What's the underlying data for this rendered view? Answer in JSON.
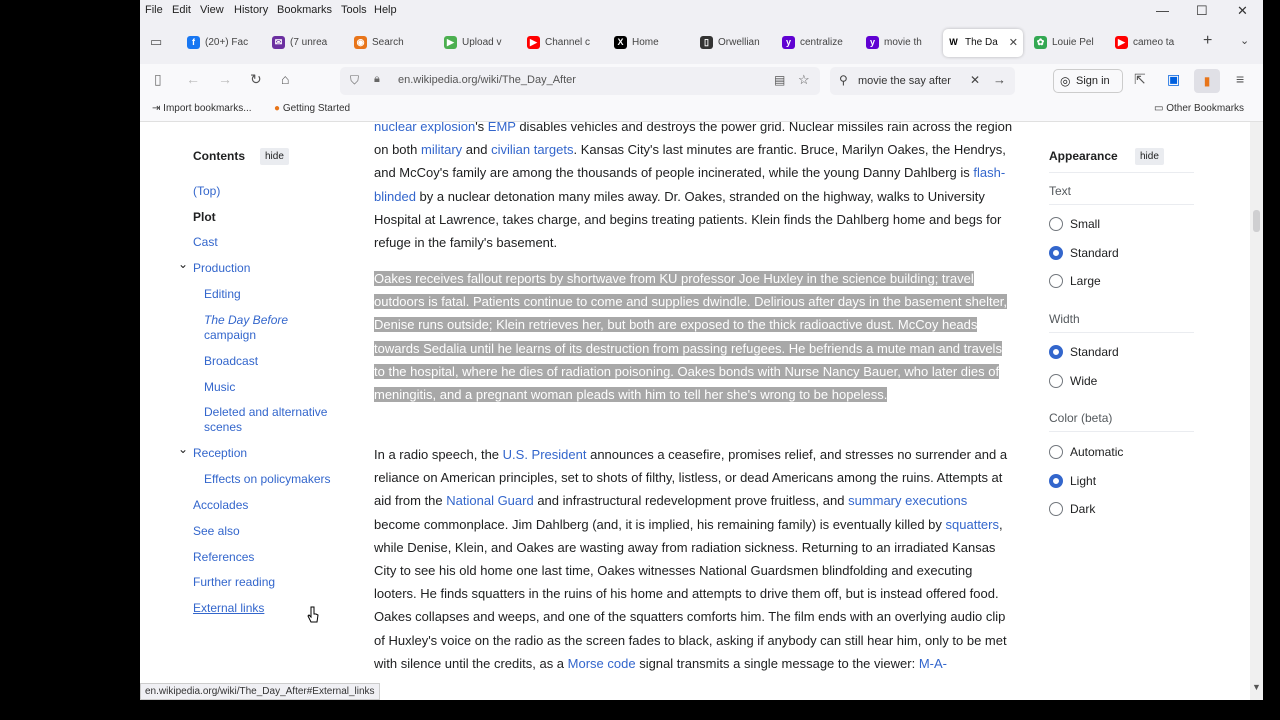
{
  "menu": [
    "File",
    "Edit",
    "View",
    "History",
    "Bookmarks",
    "Tools",
    "Help"
  ],
  "tabs": [
    {
      "label": "(20+) Fac",
      "color": "#1877f2",
      "glyph": "f"
    },
    {
      "label": "(7 unrea",
      "color": "#6b2fa0",
      "glyph": "✉"
    },
    {
      "label": "Search",
      "color": "#e8751a",
      "glyph": "◉"
    },
    {
      "label": "Upload v",
      "color": "#4caf50",
      "glyph": "▶"
    },
    {
      "label": "Channel c",
      "color": "#ff0000",
      "glyph": "▶"
    },
    {
      "label": "Home",
      "color": "#000000",
      "glyph": "X"
    },
    {
      "label": "Orwellian",
      "color": "#333333",
      "glyph": "▯"
    },
    {
      "label": "centralize",
      "color": "#6001d2",
      "glyph": "y"
    },
    {
      "label": "movie th",
      "color": "#6001d2",
      "glyph": "y"
    },
    {
      "label": "The Da",
      "color": "#ffffff",
      "glyph": "W"
    },
    {
      "label": "Louie Pel",
      "color": "#34a853",
      "glyph": "✿"
    },
    {
      "label": "cameo ta",
      "color": "#ff0000",
      "glyph": "▶"
    }
  ],
  "nav": {
    "url": "en.wikipedia.org/wiki/The_Day_After",
    "search_value": "movie the say after",
    "signin": "Sign in"
  },
  "bookmarks": {
    "import": "Import bookmarks...",
    "getting_started": "Getting Started",
    "other": "Other Bookmarks"
  },
  "toc": {
    "title": "Contents",
    "hide": "hide",
    "items": [
      {
        "label": "(Top)",
        "level": 1
      },
      {
        "label": "Plot",
        "level": 1,
        "active": true
      },
      {
        "label": "Cast",
        "level": 1
      },
      {
        "label": "Production",
        "level": 1,
        "expanded": true
      },
      {
        "label": "Editing",
        "level": 2
      },
      {
        "label": "The Day Before",
        "label2": "campaign",
        "level": 2,
        "italic": true
      },
      {
        "label": "Broadcast",
        "level": 2
      },
      {
        "label": "Music",
        "level": 2
      },
      {
        "label": "Deleted and alternative",
        "label2": "scenes",
        "level": 2
      },
      {
        "label": "Reception",
        "level": 1,
        "expanded": true
      },
      {
        "label": "Effects on policymakers",
        "level": 2
      },
      {
        "label": "Accolades",
        "level": 1
      },
      {
        "label": "See also",
        "level": 1
      },
      {
        "label": "References",
        "level": 1
      },
      {
        "label": "Further reading",
        "level": 1
      },
      {
        "label": "External links",
        "level": 1,
        "hover": true
      }
    ]
  },
  "article": {
    "p1": [
      {
        "t": "nuclear explosion",
        "link": true
      },
      {
        "t": "'s "
      },
      {
        "t": "EMP",
        "link": true
      },
      {
        "t": " disables vehicles and destroys the power grid. Nuclear missiles rain across the region on both "
      },
      {
        "t": "military",
        "link": true
      },
      {
        "t": " and "
      },
      {
        "t": "civilian targets",
        "link": true
      },
      {
        "t": ". Kansas City's last minutes are frantic. Bruce, Marilyn Oakes, the Hendrys, and McCoy's family are among the thousands of people incinerated, while the young Danny Dahlberg is "
      },
      {
        "t": "flash-blinded",
        "link": true
      },
      {
        "t": " by a nuclear detonation many miles away. Dr. Oakes, stranded on the highway, walks to University Hospital at Lawrence, takes charge, and begins treating patients. Klein finds the Dahlberg home and begs for refuge in the family's basement."
      }
    ],
    "p2": "Oakes receives fallout reports by shortwave from KU professor Joe Huxley in the science building; travel outdoors is fatal. Patients continue to come and supplies dwindle. Delirious after days in the basement shelter, Denise runs outside; Klein retrieves her, but both are exposed to the thick radioactive dust. McCoy heads towards Sedalia until he learns of its destruction from passing refugees. He befriends a mute man and travels to the hospital, where he dies of radiation poisoning. Oakes bonds with Nurse Nancy Bauer, who later dies of meningitis, and a pregnant woman pleads with him to tell her she's wrong to be hopeless.",
    "p3": [
      {
        "t": "In a radio speech, the "
      },
      {
        "t": "U.S. President",
        "link": true
      },
      {
        "t": " announces a ceasefire, promises relief, and stresses no surrender and a reliance on American principles, set to shots of filthy, listless, or dead Americans among the ruins. Attempts at aid from the "
      },
      {
        "t": "National Guard",
        "link": true
      },
      {
        "t": " and infrastructural redevelopment prove fruitless, and "
      },
      {
        "t": "summary executions",
        "link": true
      },
      {
        "t": " become commonplace. Jim Dahlberg (and, it is implied, his remaining family) is eventually killed by "
      },
      {
        "t": "squatters",
        "link": true
      },
      {
        "t": ", while Denise, Klein, and Oakes are wasting away from radiation sickness. Returning to an irradiated Kansas City to see his old home one last time, Oakes witnesses National Guardsmen blindfolding and executing looters. He finds squatters in the ruins of his home and attempts to drive them off, but is instead offered food. Oakes collapses and weeps, and one of the squatters comforts him. The film ends with an overlying audio clip of Huxley's voice on the radio as the screen fades to black, asking if anybody can still hear him, only to be met with silence until the credits, as a "
      },
      {
        "t": "Morse code",
        "link": true
      },
      {
        "t": " signal transmits a single message to the viewer: "
      },
      {
        "t": "M-A-",
        "link": true
      }
    ]
  },
  "appearance": {
    "title": "Appearance",
    "hide": "hide",
    "text_label": "Text",
    "text_options": [
      {
        "label": "Small",
        "on": false
      },
      {
        "label": "Standard",
        "on": true
      },
      {
        "label": "Large",
        "on": false
      }
    ],
    "width_label": "Width",
    "width_options": [
      {
        "label": "Standard",
        "on": true
      },
      {
        "label": "Wide",
        "on": false
      }
    ],
    "color_label": "Color (beta)",
    "color_options": [
      {
        "label": "Automatic",
        "on": false
      },
      {
        "label": "Light",
        "on": true
      },
      {
        "label": "Dark",
        "on": false
      }
    ]
  },
  "status_url": "en.wikipedia.org/wiki/The_Day_After#External_links"
}
